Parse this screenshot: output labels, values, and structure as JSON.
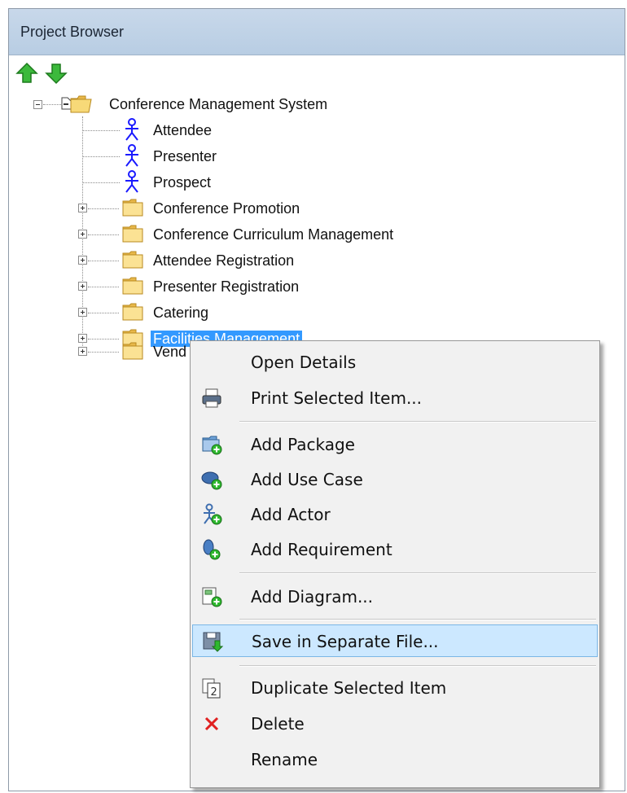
{
  "panel": {
    "title": "Project Browser"
  },
  "toolbar": {
    "up_icon": "arrow-up-icon",
    "down_icon": "arrow-down-icon"
  },
  "tree": {
    "root": "Conference Management System",
    "actors": [
      "Attendee",
      "Presenter",
      "Prospect"
    ],
    "packages": [
      "Conference Promotion",
      "Conference Curriculum Management",
      "Attendee Registration",
      "Presenter Registration",
      "Catering",
      "Facilities Management",
      "Vend"
    ],
    "selected": "Facilities Management"
  },
  "context_menu": {
    "items": [
      {
        "label": "Open Details",
        "icon": ""
      },
      {
        "label": "Print Selected Item...",
        "icon": "printer-icon"
      },
      {
        "label": "Add Package",
        "icon": "add-package-icon"
      },
      {
        "label": "Add Use Case",
        "icon": "add-use-case-icon"
      },
      {
        "label": "Add Actor",
        "icon": "add-actor-icon"
      },
      {
        "label": "Add Requirement",
        "icon": "add-requirement-icon"
      },
      {
        "label": "Add Diagram...",
        "icon": "add-diagram-icon"
      },
      {
        "label": "Save in Separate File...",
        "icon": "save-file-icon"
      },
      {
        "label": "Duplicate Selected Item",
        "icon": "duplicate-icon"
      },
      {
        "label": "Delete",
        "icon": "delete-icon"
      },
      {
        "label": "Rename",
        "icon": ""
      }
    ],
    "highlighted": "Save in Separate File..."
  },
  "colors": {
    "selection": "#3399ff",
    "menu_highlight": "#cce8ff",
    "titlebar": "#bfd2e6",
    "actor": "#1a1aff"
  }
}
